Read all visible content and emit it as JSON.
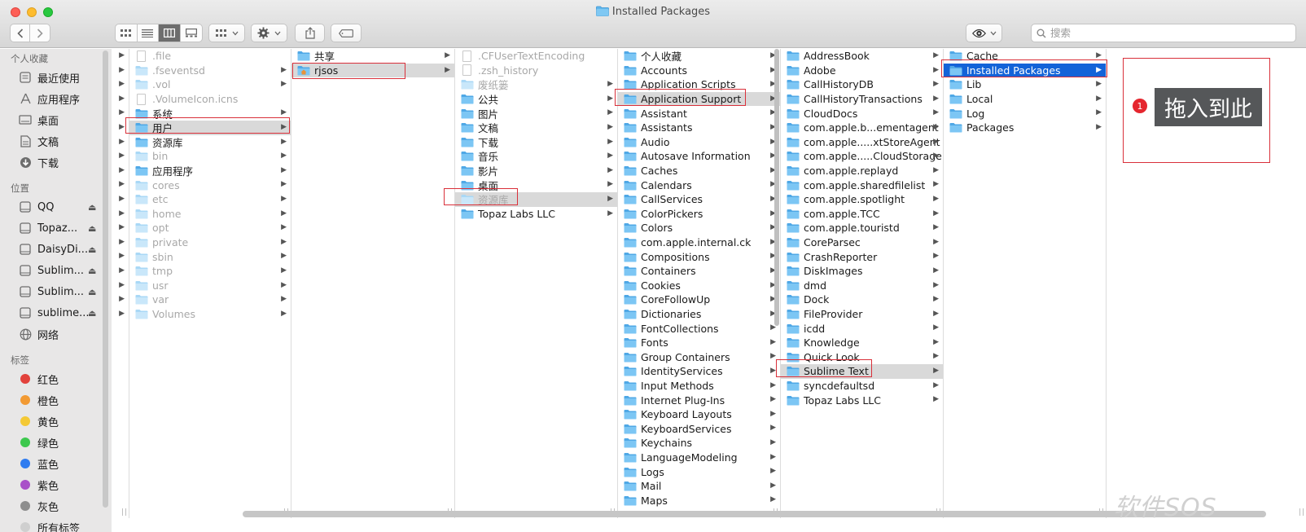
{
  "window": {
    "title": "Installed Packages"
  },
  "toolbar": {
    "gear_icon": "gear-icon",
    "share_icon": "share-icon",
    "tag_icon": "tag-icon",
    "eye_icon": "eye-icon"
  },
  "search": {
    "placeholder": "搜索"
  },
  "sidebar": {
    "favorites_header": "个人收藏",
    "favorites": [
      {
        "label": "最近使用",
        "icon": "recent-icon"
      },
      {
        "label": "应用程序",
        "icon": "applications-icon"
      },
      {
        "label": "桌面",
        "icon": "desktop-icon"
      },
      {
        "label": "文稿",
        "icon": "documents-icon"
      },
      {
        "label": "下载",
        "icon": "downloads-icon"
      }
    ],
    "locations_header": "位置",
    "locations": [
      {
        "label": "QQ"
      },
      {
        "label": "Topaz..."
      },
      {
        "label": "DaisyDi..."
      },
      {
        "label": "Sublim..."
      },
      {
        "label": "Sublim..."
      },
      {
        "label": "sublime..."
      },
      {
        "label": "网络"
      }
    ],
    "tags_header": "标签",
    "tags": [
      {
        "label": "红色",
        "color": "#e2423c"
      },
      {
        "label": "橙色",
        "color": "#f29a33"
      },
      {
        "label": "黄色",
        "color": "#f4c935"
      },
      {
        "label": "绿色",
        "color": "#3dc84e"
      },
      {
        "label": "蓝色",
        "color": "#2f7cf0"
      },
      {
        "label": "紫色",
        "color": "#a951c8"
      },
      {
        "label": "灰色",
        "color": "#8e8e8e"
      },
      {
        "label": "所有标签"
      }
    ]
  },
  "columns": [
    {
      "items": [
        {
          "name": ".file",
          "type": "doc",
          "dim": true
        },
        {
          "name": ".fseventsd",
          "type": "folder",
          "dim": true,
          "arrow": true
        },
        {
          "name": ".vol",
          "type": "folder",
          "dim": true,
          "arrow": true
        },
        {
          "name": ".VolumeIcon.icns",
          "type": "doc",
          "dim": true
        },
        {
          "name": "系统",
          "type": "folder",
          "arrow": true
        },
        {
          "name": "用户",
          "type": "folder",
          "arrow": true,
          "selected": true
        },
        {
          "name": "资源库",
          "type": "folder",
          "arrow": true
        },
        {
          "name": "bin",
          "type": "folder",
          "dim": true,
          "arrow": true
        },
        {
          "name": "应用程序",
          "type": "folder",
          "arrow": true
        },
        {
          "name": "cores",
          "type": "folder",
          "dim": true,
          "arrow": true
        },
        {
          "name": "etc",
          "type": "folder",
          "dim": true,
          "arrow": true
        },
        {
          "name": "home",
          "type": "folder",
          "dim": true,
          "arrow": true
        },
        {
          "name": "opt",
          "type": "folder",
          "dim": true,
          "arrow": true
        },
        {
          "name": "private",
          "type": "folder",
          "dim": true,
          "arrow": true
        },
        {
          "name": "sbin",
          "type": "folder",
          "dim": true,
          "arrow": true
        },
        {
          "name": "tmp",
          "type": "folder",
          "dim": true,
          "arrow": true
        },
        {
          "name": "usr",
          "type": "folder",
          "dim": true,
          "arrow": true
        },
        {
          "name": "var",
          "type": "folder",
          "dim": true,
          "arrow": true
        },
        {
          "name": "Volumes",
          "type": "folder",
          "dim": true,
          "arrow": true
        }
      ]
    },
    {
      "items": [
        {
          "name": "共享",
          "type": "folder",
          "arrow": true
        },
        {
          "name": "rjsos",
          "type": "home",
          "arrow": true,
          "selected": true
        }
      ]
    },
    {
      "items": [
        {
          "name": ".CFUserTextEncoding",
          "type": "doc",
          "dim": true
        },
        {
          "name": ".zsh_history",
          "type": "doc",
          "dim": true
        },
        {
          "name": "废纸篓",
          "type": "folder",
          "dim": true,
          "arrow": true
        },
        {
          "name": "公共",
          "type": "folder",
          "arrow": true
        },
        {
          "name": "图片",
          "type": "folder",
          "arrow": true
        },
        {
          "name": "文稿",
          "type": "folder",
          "arrow": true
        },
        {
          "name": "下载",
          "type": "folder",
          "arrow": true
        },
        {
          "name": "音乐",
          "type": "folder",
          "arrow": true
        },
        {
          "name": "影片",
          "type": "folder",
          "arrow": true
        },
        {
          "name": "桌面",
          "type": "folder",
          "arrow": true
        },
        {
          "name": "资源库",
          "type": "folder",
          "dim": true,
          "arrow": true,
          "selected": true
        },
        {
          "name": "Topaz Labs LLC",
          "type": "folder",
          "arrow": true
        }
      ]
    },
    {
      "items": [
        {
          "name": "个人收藏",
          "type": "folder",
          "arrow": true
        },
        {
          "name": "Accounts",
          "type": "folder",
          "arrow": true
        },
        {
          "name": "Application Scripts",
          "type": "folder",
          "arrow": true
        },
        {
          "name": "Application Support",
          "type": "folder",
          "arrow": true,
          "selected": true
        },
        {
          "name": "Assistant",
          "type": "folder",
          "arrow": true
        },
        {
          "name": "Assistants",
          "type": "folder",
          "arrow": true
        },
        {
          "name": "Audio",
          "type": "folder",
          "arrow": true
        },
        {
          "name": "Autosave Information",
          "type": "folder",
          "arrow": true
        },
        {
          "name": "Caches",
          "type": "folder",
          "arrow": true
        },
        {
          "name": "Calendars",
          "type": "folder",
          "arrow": true
        },
        {
          "name": "CallServices",
          "type": "folder",
          "arrow": true
        },
        {
          "name": "ColorPickers",
          "type": "folder",
          "arrow": true
        },
        {
          "name": "Colors",
          "type": "folder",
          "arrow": true
        },
        {
          "name": "com.apple.internal.ck",
          "type": "folder",
          "arrow": true
        },
        {
          "name": "Compositions",
          "type": "folder",
          "arrow": true
        },
        {
          "name": "Containers",
          "type": "folder",
          "arrow": true
        },
        {
          "name": "Cookies",
          "type": "folder",
          "arrow": true
        },
        {
          "name": "CoreFollowUp",
          "type": "folder",
          "arrow": true
        },
        {
          "name": "Dictionaries",
          "type": "folder",
          "arrow": true
        },
        {
          "name": "FontCollections",
          "type": "folder",
          "arrow": true
        },
        {
          "name": "Fonts",
          "type": "folder",
          "arrow": true
        },
        {
          "name": "Group Containers",
          "type": "folder",
          "arrow": true
        },
        {
          "name": "IdentityServices",
          "type": "folder",
          "arrow": true
        },
        {
          "name": "Input Methods",
          "type": "folder",
          "arrow": true
        },
        {
          "name": "Internet Plug-Ins",
          "type": "folder",
          "arrow": true
        },
        {
          "name": "Keyboard Layouts",
          "type": "folder",
          "arrow": true
        },
        {
          "name": "KeyboardServices",
          "type": "folder",
          "arrow": true
        },
        {
          "name": "Keychains",
          "type": "folder",
          "arrow": true
        },
        {
          "name": "LanguageModeling",
          "type": "folder",
          "arrow": true
        },
        {
          "name": "Logs",
          "type": "folder",
          "arrow": true
        },
        {
          "name": "Mail",
          "type": "folder",
          "arrow": true
        },
        {
          "name": "Maps",
          "type": "folder",
          "arrow": true
        }
      ]
    },
    {
      "items": [
        {
          "name": "AddressBook",
          "type": "folder",
          "arrow": true
        },
        {
          "name": "Adobe",
          "type": "folder",
          "arrow": true
        },
        {
          "name": "CallHistoryDB",
          "type": "folder",
          "arrow": true
        },
        {
          "name": "CallHistoryTransactions",
          "type": "folder",
          "arrow": true
        },
        {
          "name": "CloudDocs",
          "type": "folder",
          "arrow": true
        },
        {
          "name": "com.apple.b...ementagent",
          "type": "folder",
          "arrow": true
        },
        {
          "name": "com.apple.....xtStoreAgent",
          "type": "folder",
          "arrow": true
        },
        {
          "name": "com.apple.....CloudStorage",
          "type": "folder",
          "arrow": true
        },
        {
          "name": "com.apple.replayd",
          "type": "folder",
          "arrow": true
        },
        {
          "name": "com.apple.sharedfilelist",
          "type": "folder",
          "arrow": true
        },
        {
          "name": "com.apple.spotlight",
          "type": "folder",
          "arrow": true
        },
        {
          "name": "com.apple.TCC",
          "type": "folder",
          "arrow": true
        },
        {
          "name": "com.apple.touristd",
          "type": "folder",
          "arrow": true
        },
        {
          "name": "CoreParsec",
          "type": "folder",
          "arrow": true
        },
        {
          "name": "CrashReporter",
          "type": "folder",
          "arrow": true
        },
        {
          "name": "DiskImages",
          "type": "folder",
          "arrow": true
        },
        {
          "name": "dmd",
          "type": "folder",
          "arrow": true
        },
        {
          "name": "Dock",
          "type": "folder",
          "arrow": true
        },
        {
          "name": "FileProvider",
          "type": "folder",
          "arrow": true
        },
        {
          "name": "icdd",
          "type": "folder",
          "arrow": true
        },
        {
          "name": "Knowledge",
          "type": "folder",
          "arrow": true
        },
        {
          "name": "Quick Look",
          "type": "folder",
          "arrow": true
        },
        {
          "name": "Sublime Text",
          "type": "folder",
          "arrow": true,
          "selected": true
        },
        {
          "name": "syncdefaultsd",
          "type": "folder",
          "arrow": true
        },
        {
          "name": "Topaz Labs LLC",
          "type": "folder",
          "arrow": true
        }
      ]
    },
    {
      "items": [
        {
          "name": "Cache",
          "type": "folder",
          "arrow": true
        },
        {
          "name": "Installed Packages",
          "type": "folder",
          "arrow": true,
          "active": true
        },
        {
          "name": "Lib",
          "type": "folder",
          "arrow": true
        },
        {
          "name": "Local",
          "type": "folder",
          "arrow": true
        },
        {
          "name": "Log",
          "type": "folder",
          "arrow": true
        },
        {
          "name": "Packages",
          "type": "folder",
          "arrow": true
        }
      ]
    },
    {
      "items": []
    }
  ],
  "annotation": {
    "badge": "1",
    "callout": "拖入到此"
  },
  "watermark": "软件SOS"
}
